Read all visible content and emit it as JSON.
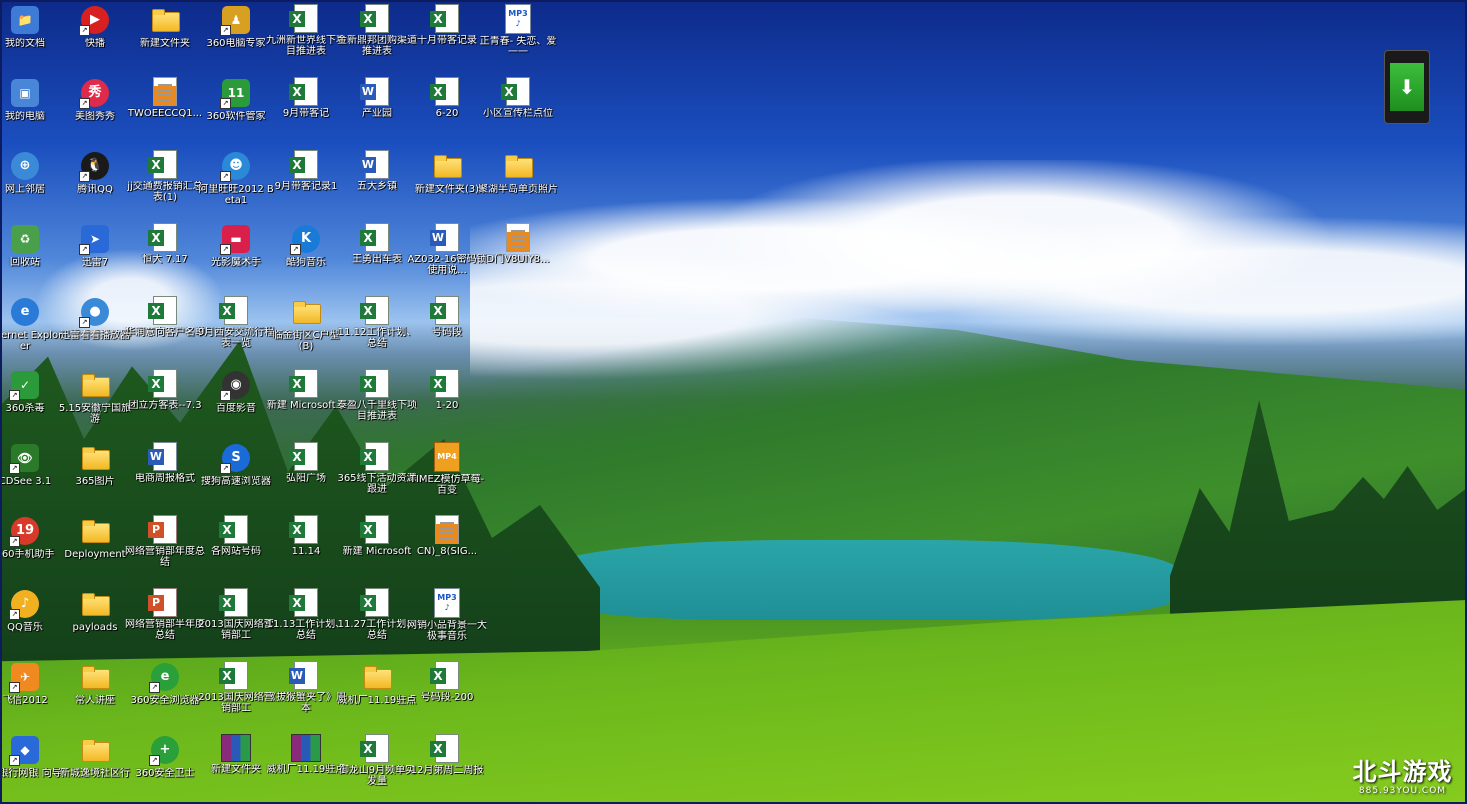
{
  "desktop": {
    "icons": [
      {
        "label": "我的文档",
        "type": "folder-docs",
        "col": 0,
        "row": 0,
        "color": "#3d7bd6"
      },
      {
        "label": "我的电脑",
        "type": "computer",
        "col": 0,
        "row": 1,
        "color": "#4a86d8"
      },
      {
        "label": "网上邻居",
        "type": "network",
        "col": 0,
        "row": 2,
        "color": "#3a8ad8"
      },
      {
        "label": "回收站",
        "type": "recycle",
        "col": 0,
        "row": 3,
        "color": "#4aa04a"
      },
      {
        "label": "Internet Explorer",
        "type": "ie",
        "col": 0,
        "row": 4,
        "color": "#2a7ad8"
      },
      {
        "label": "360杀毒",
        "type": "360av",
        "col": 0,
        "row": 5,
        "color": "#2a9a3a",
        "shortcut": true
      },
      {
        "label": "CDSee 3.1",
        "type": "acdsee",
        "col": 0,
        "row": 6,
        "color": "#2a7a2a",
        "shortcut": true
      },
      {
        "label": "360手机助手",
        "type": "360phone",
        "col": 0,
        "row": 7,
        "color": "#d83a2a",
        "shortcut": true
      },
      {
        "label": "QQ音乐",
        "type": "qqmusic",
        "col": 0,
        "row": 8,
        "color": "#f0b020",
        "shortcut": true
      },
      {
        "label": "飞信2012",
        "type": "fetion",
        "col": 0,
        "row": 9,
        "color": "#f08a20",
        "shortcut": true
      },
      {
        "label": "通银行网银 向导",
        "type": "bank",
        "col": 0,
        "row": 10,
        "color": "#2a6ad8",
        "shortcut": true
      },
      {
        "label": "快播",
        "type": "qvod",
        "col": 1,
        "row": 0,
        "color": "#d82020",
        "shortcut": true
      },
      {
        "label": "美图秀秀",
        "type": "meitu",
        "col": 1,
        "row": 1,
        "color": "#e02a4a",
        "shortcut": true
      },
      {
        "label": "腾讯QQ",
        "type": "qq",
        "col": 1,
        "row": 2,
        "color": "#1a1a1a",
        "shortcut": true
      },
      {
        "label": "迅雷7",
        "type": "xunlei",
        "col": 1,
        "row": 3,
        "color": "#2a6ad8",
        "shortcut": true
      },
      {
        "label": "迅雷看看播放器",
        "type": "kankan",
        "col": 1,
        "row": 4,
        "color": "#3a8ad8",
        "shortcut": true
      },
      {
        "label": "5.15安徽宁国旅游",
        "type": "folder",
        "col": 1,
        "row": 5
      },
      {
        "label": "365图片",
        "type": "folder",
        "col": 1,
        "row": 6
      },
      {
        "label": "Deployment",
        "type": "folder",
        "col": 1,
        "row": 7
      },
      {
        "label": "payloads",
        "type": "folder",
        "col": 1,
        "row": 8
      },
      {
        "label": "常人讲座",
        "type": "folder",
        "col": 1,
        "row": 9
      },
      {
        "label": "新城逸境社区行",
        "type": "folder",
        "col": 1,
        "row": 10
      },
      {
        "label": "新建文件夹",
        "type": "folder",
        "col": 2,
        "row": 0
      },
      {
        "label": "TWOEECCQ1...",
        "type": "doc-orange",
        "col": 2,
        "row": 1
      },
      {
        "label": "jj交通费报销汇总表(1)",
        "type": "excel",
        "col": 2,
        "row": 2
      },
      {
        "label": "恒大 7.17",
        "type": "excel",
        "col": 2,
        "row": 3
      },
      {
        "label": "华润意向客户名单",
        "type": "excel",
        "col": 2,
        "row": 4
      },
      {
        "label": "团立方客表--7.3",
        "type": "excel",
        "col": 2,
        "row": 5
      },
      {
        "label": "电商周报格式",
        "type": "word",
        "col": 2,
        "row": 6
      },
      {
        "label": "网络营销部年度总结",
        "type": "ppt",
        "col": 2,
        "row": 7
      },
      {
        "label": "网络营销部半年度总结",
        "type": "ppt",
        "col": 2,
        "row": 8
      },
      {
        "label": "360安全浏览器",
        "type": "360browser",
        "col": 2,
        "row": 9,
        "color": "#2aa03a",
        "shortcut": true
      },
      {
        "label": "360安全卫士",
        "type": "360safe",
        "col": 2,
        "row": 10,
        "color": "#2aa03a",
        "shortcut": true
      },
      {
        "label": "360电脑专家",
        "type": "360expert",
        "col": 3,
        "row": 0,
        "color": "#d8a020",
        "shortcut": true
      },
      {
        "label": "360软件管家",
        "type": "360soft",
        "col": 3,
        "row": 1,
        "color": "#2a9a3a",
        "shortcut": true
      },
      {
        "label": "阿里旺旺2012 Beta1",
        "type": "wangwang",
        "col": 3,
        "row": 2,
        "color": "#2a8ad8",
        "shortcut": true
      },
      {
        "label": "光影魔术手",
        "type": "nevercolor",
        "col": 3,
        "row": 3,
        "color": "#d8204a",
        "shortcut": true
      },
      {
        "label": "9月西安交流行程表一览",
        "type": "excel",
        "col": 3,
        "row": 4
      },
      {
        "label": "百度影音",
        "type": "baiduyy",
        "col": 3,
        "row": 5,
        "color": "#333333",
        "shortcut": true
      },
      {
        "label": "搜狗高速浏览器",
        "type": "sogou",
        "col": 3,
        "row": 6,
        "color": "#1a6ad8",
        "shortcut": true
      },
      {
        "label": "各网站号码",
        "type": "excel",
        "col": 3,
        "row": 7
      },
      {
        "label": "2013国庆网络营销部工",
        "type": "excel",
        "col": 3,
        "row": 8
      },
      {
        "label": "2013国庆网络营销部工",
        "type": "excel",
        "col": 3,
        "row": 9
      },
      {
        "label": "新建文件夹",
        "type": "rar",
        "col": 3,
        "row": 10
      },
      {
        "label": "九洲新世界线下项目推进表",
        "type": "excel",
        "col": 4,
        "row": 0
      },
      {
        "label": "9月带客记",
        "type": "excel",
        "col": 4,
        "row": 1
      },
      {
        "label": "9月带客记录1",
        "type": "excel",
        "col": 4,
        "row": 2
      },
      {
        "label": "酷狗音乐",
        "type": "kugou",
        "col": 4,
        "row": 3,
        "color": "#1a7ad8",
        "shortcut": true
      },
      {
        "label": "临金街区C户型(B)",
        "type": "folder",
        "col": 4,
        "row": 4
      },
      {
        "label": "新建 Microsoft...",
        "type": "excel",
        "col": 4,
        "row": 5
      },
      {
        "label": "弘阳广场",
        "type": "excel",
        "col": 4,
        "row": 6
      },
      {
        "label": "11.14",
        "type": "excel",
        "col": 4,
        "row": 7
      },
      {
        "label": "11.13工作计划、总结",
        "type": "excel",
        "col": 4,
        "row": 8
      },
      {
        "label": "《拔猴蟹夹了》周本",
        "type": "word",
        "col": 4,
        "row": 9
      },
      {
        "label": "威机厂11.19驻点",
        "type": "rar",
        "col": 4,
        "row": 10
      },
      {
        "label": "金新鼎邦团购渠道推进表",
        "type": "excel",
        "col": 5,
        "row": 0
      },
      {
        "label": "产业园",
        "type": "word",
        "col": 5,
        "row": 1
      },
      {
        "label": "五大乡镇",
        "type": "word",
        "col": 5,
        "row": 2
      },
      {
        "label": "王勇出车表",
        "type": "excel",
        "col": 5,
        "row": 3
      },
      {
        "label": "11.12工作计划、总结",
        "type": "excel",
        "col": 5,
        "row": 4
      },
      {
        "label": "泰盈八千里线下项目推进表",
        "type": "excel",
        "col": 5,
        "row": 5
      },
      {
        "label": "365线下活动资源跟进",
        "type": "excel",
        "col": 5,
        "row": 6
      },
      {
        "label": "新建 Microsoft",
        "type": "excel",
        "col": 5,
        "row": 7
      },
      {
        "label": "11.27工作计划、总结",
        "type": "excel",
        "col": 5,
        "row": 8
      },
      {
        "label": "威机厂11.19驻点",
        "type": "folder",
        "col": 5,
        "row": 9
      },
      {
        "label": "御龙山9月频单实发量",
        "type": "excel",
        "col": 5,
        "row": 10
      },
      {
        "label": "十月带客记录",
        "type": "excel",
        "col": 6,
        "row": 0
      },
      {
        "label": "6-20",
        "type": "excel",
        "col": 6,
        "row": 1
      },
      {
        "label": "新建文件夹(3)",
        "type": "folder",
        "col": 6,
        "row": 2
      },
      {
        "label": "AZ032-16密码锁使用说...",
        "type": "word",
        "col": 6,
        "row": 3
      },
      {
        "label": "号码段",
        "type": "excel",
        "col": 6,
        "row": 4
      },
      {
        "label": "1-20",
        "type": "excel",
        "col": 6,
        "row": 5
      },
      {
        "label": "TIMEZ模仿草莓-百变",
        "type": "mp4",
        "col": 6,
        "row": 6
      },
      {
        "label": "CN)_8(SIG...",
        "type": "doc-orange",
        "col": 6,
        "row": 7
      },
      {
        "label": "网销小品背景一大极事音乐",
        "type": "mp3",
        "col": 6,
        "row": 8
      },
      {
        "label": "号码段-200",
        "type": "excel",
        "col": 6,
        "row": 9
      },
      {
        "label": "12月第周二周报",
        "type": "excel",
        "col": 6,
        "row": 10
      },
      {
        "label": "正青春- 失恋、爱一一",
        "type": "mp3",
        "col": 7,
        "row": 0
      },
      {
        "label": "小区宣传栏点位",
        "type": "excel",
        "col": 7,
        "row": 1
      },
      {
        "label": "聚湖半岛单页照片",
        "type": "folder",
        "col": 7,
        "row": 2
      },
      {
        "label": "D门V8UIY8...",
        "type": "doc-orange",
        "col": 7,
        "row": 3
      }
    ]
  },
  "widget": {
    "icon": "download-arrow-icon",
    "accent": "#2ab02a"
  },
  "watermark": {
    "main": "北斗游戏",
    "sub": "885.93YOU.COM"
  }
}
